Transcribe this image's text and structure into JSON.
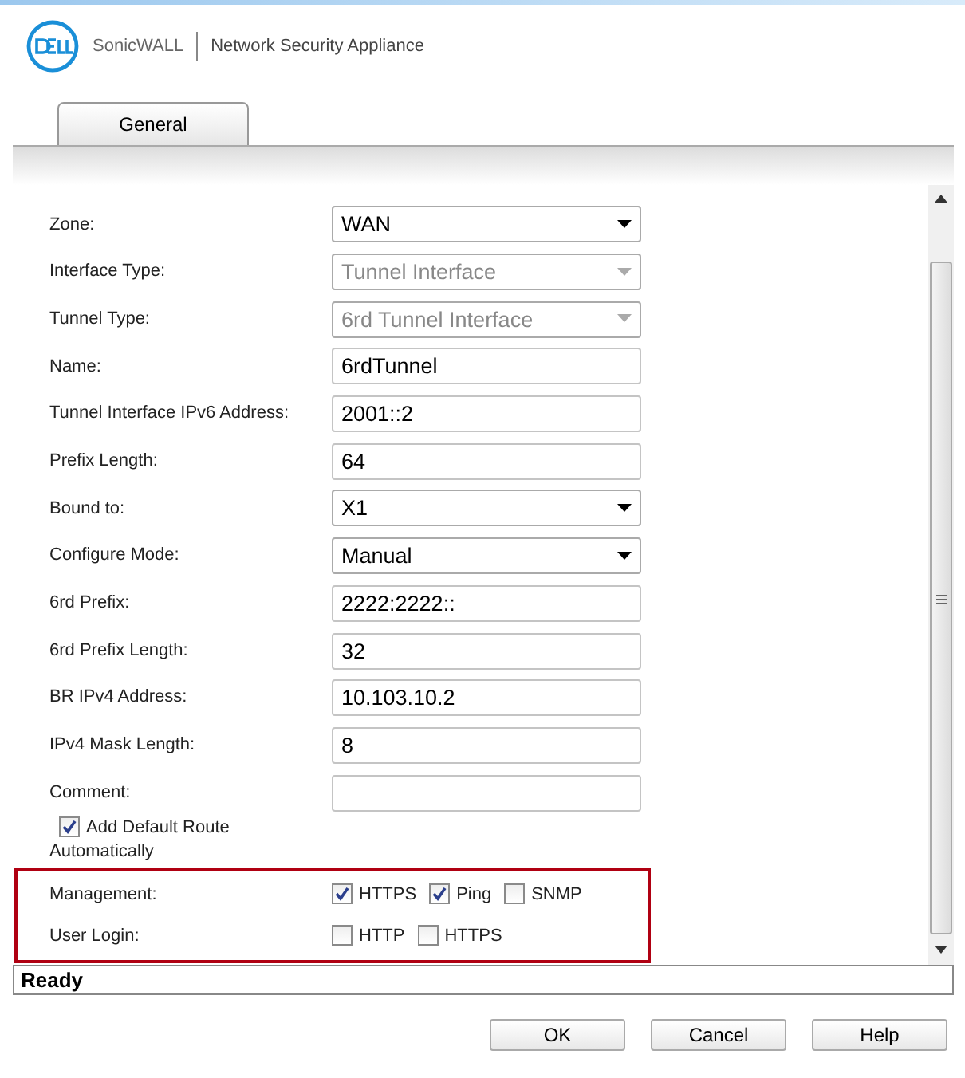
{
  "header": {
    "brand": "SonicWALL",
    "title": "Network Security Appliance"
  },
  "tabs": [
    {
      "label": "General",
      "selected": true
    }
  ],
  "fields": [
    {
      "label": "Zone:",
      "kind": "select",
      "value": "WAN",
      "disabled": false
    },
    {
      "label": "Interface Type:",
      "kind": "select",
      "value": "Tunnel Interface",
      "disabled": true
    },
    {
      "label": "Tunnel Type:",
      "kind": "select",
      "value": "6rd Tunnel Interface",
      "disabled": true
    },
    {
      "label": "Name:",
      "kind": "text",
      "value": "6rdTunnel"
    },
    {
      "label": "Tunnel Interface IPv6 Address:",
      "kind": "text",
      "value": "2001::2"
    },
    {
      "label": "Prefix Length:",
      "kind": "text",
      "value": "64"
    },
    {
      "label": "Bound to:",
      "kind": "select",
      "value": "X1",
      "disabled": false
    },
    {
      "label": "Configure Mode:",
      "kind": "select",
      "value": "Manual",
      "disabled": false
    },
    {
      "label": "6rd Prefix:",
      "kind": "text",
      "value": "2222:2222::"
    },
    {
      "label": "6rd Prefix Length:",
      "kind": "text",
      "value": "32"
    },
    {
      "label": "BR IPv4 Address:",
      "kind": "text",
      "value": "10.103.10.2"
    },
    {
      "label": "IPv4 Mask Length:",
      "kind": "text",
      "value": "8"
    },
    {
      "label": "Comment:",
      "kind": "text"
    }
  ],
  "default_route": {
    "label": "Add Default Route",
    "label_2": "Automatically",
    "checked": true
  },
  "access_groups": [
    {
      "label": "Management:",
      "options": [
        {
          "label": "HTTPS",
          "checked": true
        },
        {
          "label": "Ping",
          "checked": true
        },
        {
          "label": "SNMP",
          "checked": false
        }
      ]
    },
    {
      "label": "User Login:",
      "options": [
        {
          "label": "HTTP",
          "checked": false
        },
        {
          "label": "HTTPS",
          "checked": false
        }
      ]
    }
  ],
  "status_bar": "Ready",
  "buttons": [
    "OK",
    "Cancel",
    "Help"
  ]
}
